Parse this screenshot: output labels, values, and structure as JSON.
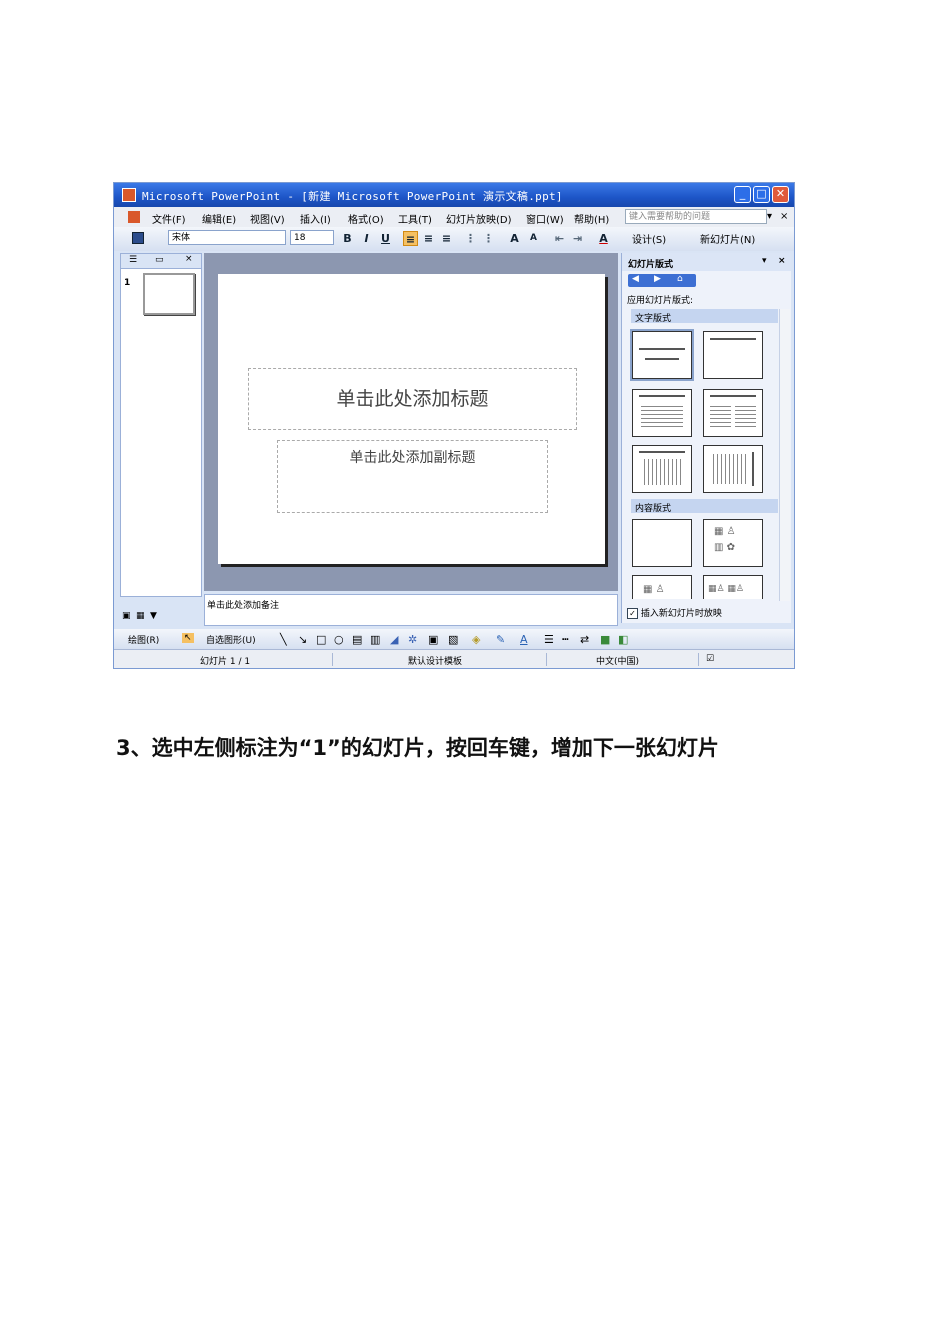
{
  "window": {
    "title": "Microsoft PowerPoint - [新建 Microsoft PowerPoint 演示文稿.ppt]",
    "min_glyph": "_",
    "max_glyph": "□",
    "close_glyph": "✕"
  },
  "menu": {
    "items": [
      "文件(F)",
      "编辑(E)",
      "视图(V)",
      "插入(I)",
      "格式(O)",
      "工具(T)",
      "幻灯片放映(D)",
      "窗口(W)",
      "帮助(H)"
    ],
    "help_placeholder": "键入需要帮助的问题",
    "close_glyph": "×",
    "dropdown_glyph": "▾"
  },
  "toolbar": {
    "font_name": "宋体",
    "font_size": "18",
    "bold": "B",
    "italic": "I",
    "underline": "U",
    "increase_font": "A",
    "decrease_font": "A",
    "font_color": "A",
    "design_label": "设计(S)",
    "new_slide_label": "新幻灯片(N)"
  },
  "left_pane": {
    "tab_close": "×",
    "slide_number": "1"
  },
  "slide": {
    "title_placeholder": "单击此处添加标题",
    "subtitle_placeholder": "单击此处添加副标题"
  },
  "notes": {
    "placeholder": "单击此处添加备注"
  },
  "task_pane": {
    "title": "幻灯片版式",
    "apply_label": "应用幻灯片版式:",
    "section_text_layouts": "文字版式",
    "section_content_layouts": "内容版式",
    "insert_checkbox_label": "插入新幻灯片时放映",
    "insert_checked": true,
    "close_glyph": "×",
    "menu_glyph": "▾"
  },
  "drawing_toolbar": {
    "draw_label": "绘图(R)",
    "autoshapes_label": "自选图形(U)"
  },
  "status_bar": {
    "slide_position": "幻灯片 1 / 1",
    "design_template": "默认设计模板",
    "language": "中文(中国)"
  },
  "caption": "3、选中左侧标注为“1”的幻灯片，按回车键，增加下一张幻灯片"
}
